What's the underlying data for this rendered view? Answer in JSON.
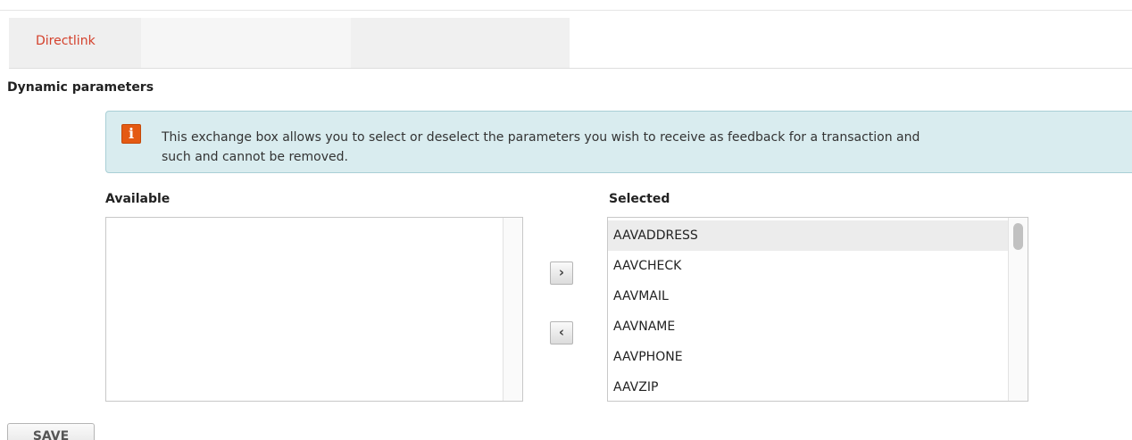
{
  "tabs": [
    {
      "label": "Directlink",
      "active": true
    },
    {
      "label": "",
      "active": false
    },
    {
      "label": "",
      "active": false
    }
  ],
  "section": {
    "title": "Dynamic parameters"
  },
  "info": {
    "icon": "info-icon",
    "line1": "This exchange box allows you to select or deselect the parameters you wish to receive as feedback for a transaction and",
    "line2": "such and cannot be removed."
  },
  "available": {
    "label": "Available",
    "items": []
  },
  "selected": {
    "label": "Selected",
    "items": [
      "AAVADDRESS",
      "AAVCHECK",
      "AAVMAIL",
      "AAVNAME",
      "AAVPHONE",
      "AAVZIP"
    ],
    "highlighted": "AAVADDRESS"
  },
  "buttons": {
    "move_right": "›",
    "move_left": "‹",
    "save": "SAVE"
  },
  "colors": {
    "tab_active_text": "#d4402b",
    "info_bg": "#d9ecef",
    "info_icon": "#e45a13"
  }
}
